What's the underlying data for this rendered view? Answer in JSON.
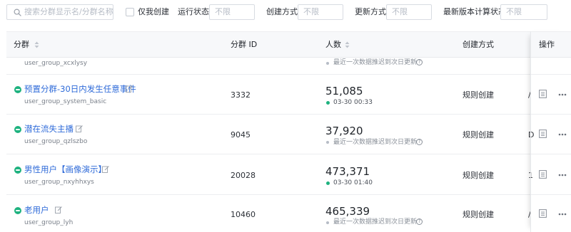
{
  "filters": {
    "search_placeholder": "搜索分群显示名/分群名称",
    "mine_only_label": "仅我创建",
    "run_status_label": "运行状态",
    "run_status_value": "不限",
    "create_method_label": "创建方式",
    "create_method_value": "不限",
    "update_method_label": "更新方式",
    "update_method_value": "不限",
    "latest_calc_label": "最新版本计算状态",
    "latest_calc_value": "不限"
  },
  "table": {
    "columns": {
      "group": "分群",
      "group_id": "分群 ID",
      "count": "人数",
      "create_method": "创建方式",
      "ops": "操作"
    },
    "partial_row": {
      "code": "user_group_xcxlysy",
      "note": "最近一次数据推迟到次日更新"
    },
    "rows": [
      {
        "name": "预置分群-30日内发生任意事件",
        "code": "user_group_system_basic",
        "id": "3332",
        "count": "51,085",
        "timestamp": "03-30 00:33",
        "note": "最近一次数据推迟到次日更新",
        "method": "规则创建",
        "clip": "/"
      },
      {
        "name": "潜在流失主播",
        "code": "user_group_qzlszbo",
        "id": "9045",
        "count": "37,920",
        "timestamp": "",
        "note": "最近一次数据推迟到次日更新",
        "method": "规则创建",
        "clip": "D"
      },
      {
        "name": "男性用户【画像演示】",
        "code": "user_group_nxyhhxys",
        "id": "20028",
        "count": "473,371",
        "timestamp": "03-30 01:40",
        "note": "",
        "method": "规则创建",
        "clip": "1"
      },
      {
        "name": "老用户",
        "code": "user_group_lyh",
        "id": "10460",
        "count": "465,339",
        "timestamp": "",
        "note": "最近一次数据推迟到次日更新",
        "method": "规则创建",
        "clip": "/"
      }
    ]
  },
  "colors": {
    "link": "#2f6bd9",
    "status_green": "#1eb27f"
  }
}
